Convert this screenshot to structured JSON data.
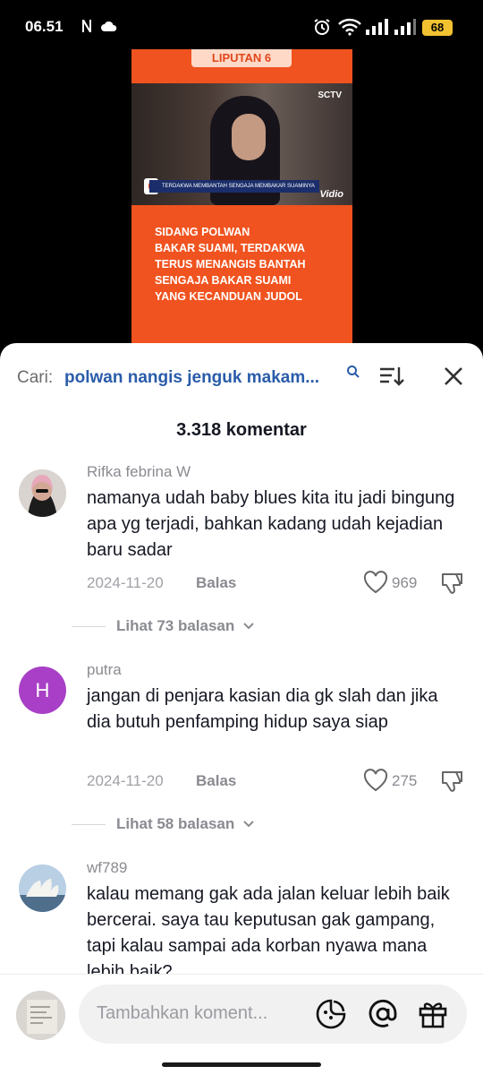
{
  "status_bar": {
    "time": "06.51",
    "battery": "68"
  },
  "video": {
    "banner": "LIPUTAN 6",
    "channel": "SCTV",
    "ticker": "TERDAKWA MEMBANTAH SENGAJA MEMBAKAR SUAMINYA",
    "watermark": "Vidio",
    "headline": "SIDANG POLWAN\nBAKAR SUAMI, TERDAKWA\nTERUS MENANGIS BANTAH\nSENGAJA BAKAR SUAMI\nYANG KECANDUAN JUDOL"
  },
  "search": {
    "prefix": "Cari:",
    "query": "polwan nangis jenguk makam..."
  },
  "comment_count": "3.318 komentar",
  "comments": [
    {
      "user": "Rifka febrina W",
      "text": "namanya udah baby blues kita itu jadi bingung apa yg terjadi, bahkan kadang udah kejadian baru sadar",
      "date": "2024-11-20",
      "reply_label": "Balas",
      "likes": "969",
      "view_replies": "Lihat 73 balasan"
    },
    {
      "user": "putra",
      "avatar_letter": "H",
      "text": "jangan di penjara kasian dia gk slah dan jika dia butuh penfamping hidup saya siap",
      "date": "2024-11-20",
      "reply_label": "Balas",
      "likes": "275",
      "view_replies": "Lihat 58 balasan"
    },
    {
      "user": "wf789",
      "text": "kalau memang gak ada jalan keluar lebih baik bercerai. saya tau keputusan gak gampang, tapi kalau sampai ada korban nyawa mana lebih baik?"
    }
  ],
  "composer": {
    "placeholder": "Tambahkan koment..."
  },
  "colors": {
    "accent": "#2a5caa",
    "video_orange": "#f0531f",
    "avatar_purple": "#a83fc6",
    "battery": "#f2c230"
  }
}
